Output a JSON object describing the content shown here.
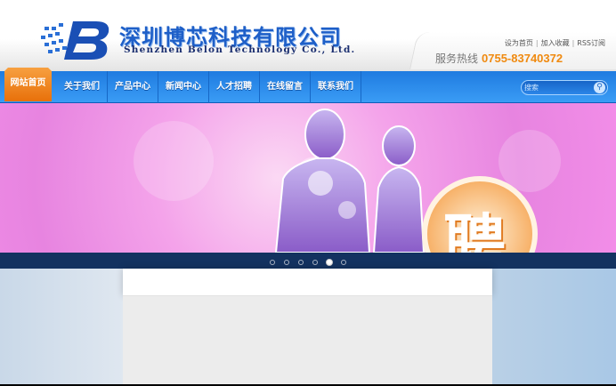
{
  "header": {
    "logo_letter": "B",
    "company_cn": "深圳博芯科技有限公司",
    "company_en": "Shenzhen Belon Technology Co., Ltd.",
    "top_links": [
      "设为首页",
      "加入收藏",
      "RSS订阅"
    ],
    "hotline_label": "服务热线",
    "hotline_number": "0755-83740372"
  },
  "nav": {
    "items": [
      "网站首页",
      "关于我们",
      "产品中心",
      "新闻中心",
      "人才招聘",
      "在线留言",
      "联系我们"
    ],
    "active_index": 0,
    "search_placeholder": "搜索"
  },
  "banner": {
    "badge_text": "聘",
    "slide_count": 6,
    "active_slide": 5
  },
  "colors": {
    "nav_blue": "#2a8ae8",
    "home_orange": "#f08a20",
    "hotline_orange": "#f08a10",
    "slider_bar": "#133260"
  }
}
